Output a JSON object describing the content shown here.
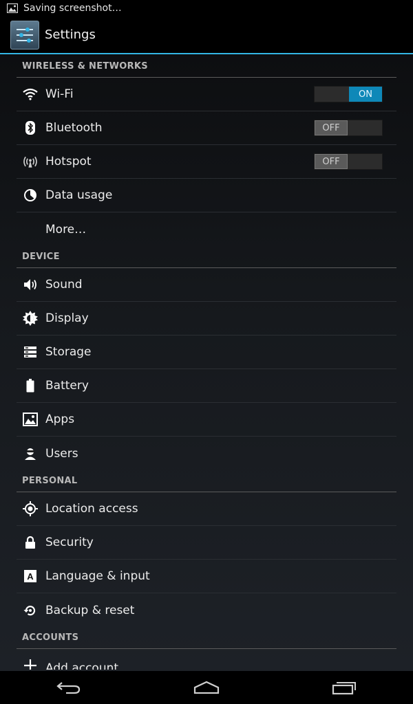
{
  "status_bar": {
    "notification_text": "Saving screenshot…"
  },
  "action_bar": {
    "title": "Settings"
  },
  "sections": {
    "wireless": {
      "header": "WIRELESS & NETWORKS",
      "wifi": {
        "label": "Wi-Fi",
        "toggle": "ON"
      },
      "bluetooth": {
        "label": "Bluetooth",
        "toggle": "OFF"
      },
      "hotspot": {
        "label": "Hotspot",
        "toggle": "OFF"
      },
      "data_usage": {
        "label": "Data usage"
      },
      "more": {
        "label": "More…"
      }
    },
    "device": {
      "header": "DEVICE",
      "sound": {
        "label": "Sound"
      },
      "display": {
        "label": "Display"
      },
      "storage": {
        "label": "Storage"
      },
      "battery": {
        "label": "Battery"
      },
      "apps": {
        "label": "Apps"
      },
      "users": {
        "label": "Users"
      }
    },
    "personal": {
      "header": "PERSONAL",
      "location": {
        "label": "Location access"
      },
      "security": {
        "label": "Security"
      },
      "language": {
        "label": "Language & input"
      },
      "backup": {
        "label": "Backup & reset"
      }
    },
    "accounts": {
      "header": "ACCOUNTS",
      "add_account": {
        "label": "Add account"
      }
    }
  },
  "colors": {
    "accent": "#33b5e5",
    "toggle_on": "#0e88b8"
  },
  "nav_bar": {
    "icons": [
      "back-icon",
      "home-icon",
      "recents-icon"
    ]
  }
}
